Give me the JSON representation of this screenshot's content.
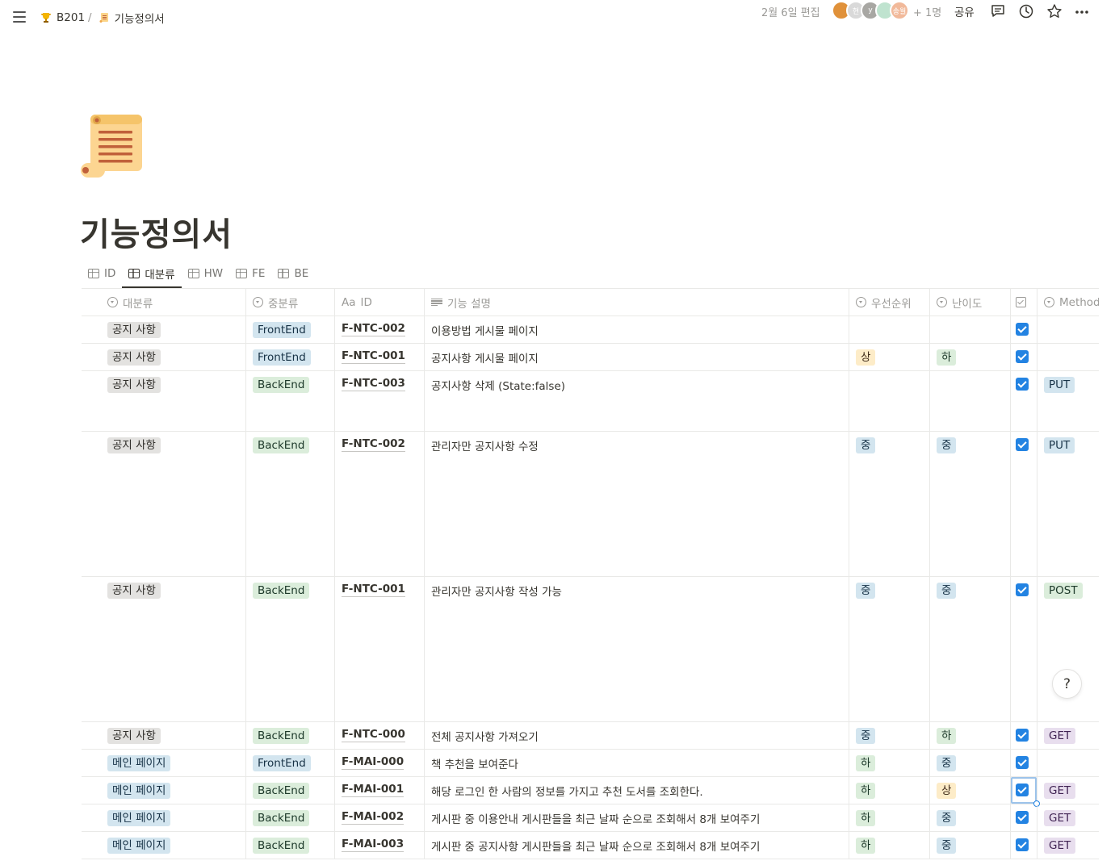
{
  "breadcrumb": {
    "parent": "B201",
    "separator": "/",
    "current": "기능정의서"
  },
  "topbar": {
    "edited": "2월 6일 편집",
    "avatars": [
      {
        "label": "",
        "color": "#e0913a"
      },
      {
        "label": "현",
        "color": "#d9d9d9"
      },
      {
        "label": "y",
        "color": "#a8a7a3"
      },
      {
        "label": "",
        "color": "#bfe3cf"
      },
      {
        "label": "송월",
        "color": "#f1b99a"
      }
    ],
    "plus_count": "+ 1명",
    "share_label": "공유",
    "icons": [
      "comment-icon",
      "history-icon",
      "star-icon",
      "more-icon"
    ]
  },
  "page": {
    "title": "기능정의서",
    "icon": "scroll-icon"
  },
  "tabs": [
    {
      "label": "ID",
      "active": false
    },
    {
      "label": "대분류",
      "active": true
    },
    {
      "label": "HW",
      "active": false
    },
    {
      "label": "FE",
      "active": false
    },
    {
      "label": "BE",
      "active": false
    }
  ],
  "table": {
    "columns": [
      "대분류",
      "중분류",
      "ID",
      "기능 설명",
      "우선순위",
      "난이도",
      "",
      "Method"
    ],
    "id_col_prefix": "Aa",
    "rows": [
      {
        "cat": "공지 사항",
        "sub": "FrontEnd",
        "id": "F-NTC-002",
        "desc": "이용방법 게시물 페이지",
        "priority": "",
        "difficulty": "",
        "done": true,
        "method": "",
        "tall": 0
      },
      {
        "cat": "공지 사항",
        "sub": "FrontEnd",
        "id": "F-NTC-001",
        "desc": "공지사항 게시물 페이지",
        "priority": "상",
        "difficulty": "하",
        "done": true,
        "method": "",
        "tall": 0
      },
      {
        "cat": "공지 사항",
        "sub": "BackEnd",
        "id": "F-NTC-003",
        "desc": "공지사항 삭제 (State:false)",
        "priority": "",
        "difficulty": "",
        "done": true,
        "method": "PUT",
        "tall": 1
      },
      {
        "cat": "공지 사항",
        "sub": "BackEnd",
        "id": "F-NTC-002",
        "desc": "관리자만 공지사항 수정",
        "priority": "중",
        "difficulty": "중",
        "done": true,
        "method": "PUT",
        "tall": 2
      },
      {
        "cat": "공지 사항",
        "sub": "BackEnd",
        "id": "F-NTC-001",
        "desc": "관리자만 공지사항 작성 가능",
        "priority": "중",
        "difficulty": "중",
        "done": true,
        "method": "POST",
        "tall": 2
      },
      {
        "cat": "공지 사항",
        "sub": "BackEnd",
        "id": "F-NTC-000",
        "desc": "전체 공지사항 가져오기",
        "priority": "중",
        "difficulty": "하",
        "done": true,
        "method": "GET",
        "tall": 0
      },
      {
        "cat": "메인 페이지",
        "sub": "FrontEnd",
        "id": "F-MAI-000",
        "desc": "책 추천을 보여준다",
        "priority": "하",
        "difficulty": "중",
        "done": true,
        "method": "",
        "tall": 0
      },
      {
        "cat": "메인 페이지",
        "sub": "BackEnd",
        "id": "F-MAI-001",
        "desc": "해당 로그인 한 사람의 정보를 가지고 추천 도서를 조회한다.",
        "priority": "하",
        "difficulty": "상",
        "done": true,
        "method": "GET",
        "tall": 0,
        "selected": true
      },
      {
        "cat": "메인 페이지",
        "sub": "BackEnd",
        "id": "F-MAI-002",
        "desc": "게시판 중 이용안내 게시판들을 최근 날짜 순으로 조회해서 8개 보여주기",
        "priority": "하",
        "difficulty": "중",
        "done": true,
        "method": "GET",
        "tall": 0
      },
      {
        "cat": "메인 페이지",
        "sub": "BackEnd",
        "id": "F-MAI-003",
        "desc": "게시판 중 공지사항 게시판들을 최근 날짜 순으로 조회해서 8개 보여주기",
        "priority": "하",
        "difficulty": "중",
        "done": true,
        "method": "GET",
        "tall": 0
      }
    ]
  },
  "help_label": "?"
}
